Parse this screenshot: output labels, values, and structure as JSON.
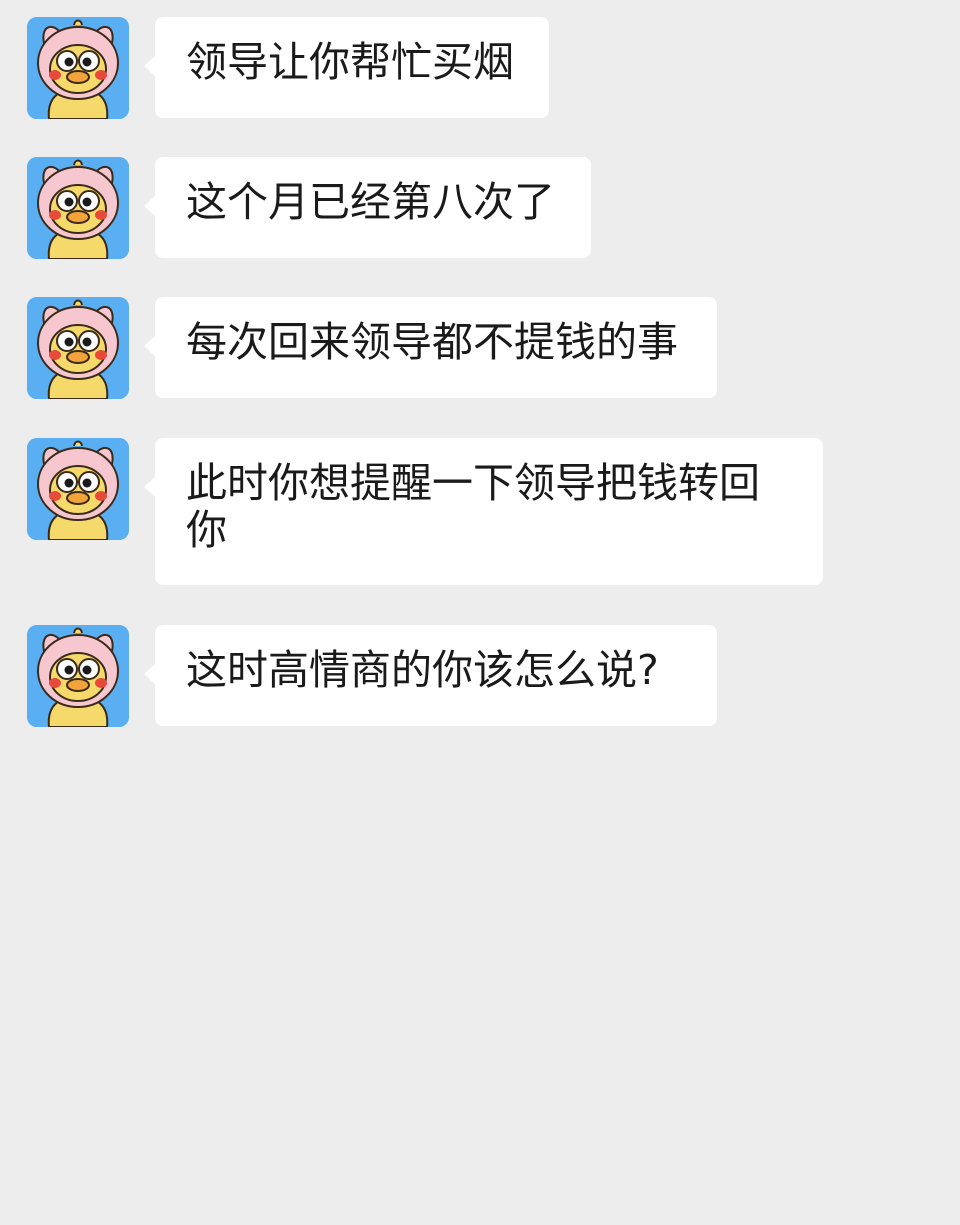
{
  "chat": {
    "background": "#ededed",
    "bubble_color": "#ffffff",
    "avatar": {
      "description_icon": "duck-in-pink-pig-hood-avatar-icon"
    },
    "messages": [
      {
        "text": "领导让你帮忙买烟"
      },
      {
        "text": "这个月已经第八次了"
      },
      {
        "text": "每次回来领导都不提钱的事"
      },
      {
        "text": "此时你想提醒一下领导把钱转回你"
      },
      {
        "text": "这时高情商的你该怎么说?"
      }
    ]
  }
}
